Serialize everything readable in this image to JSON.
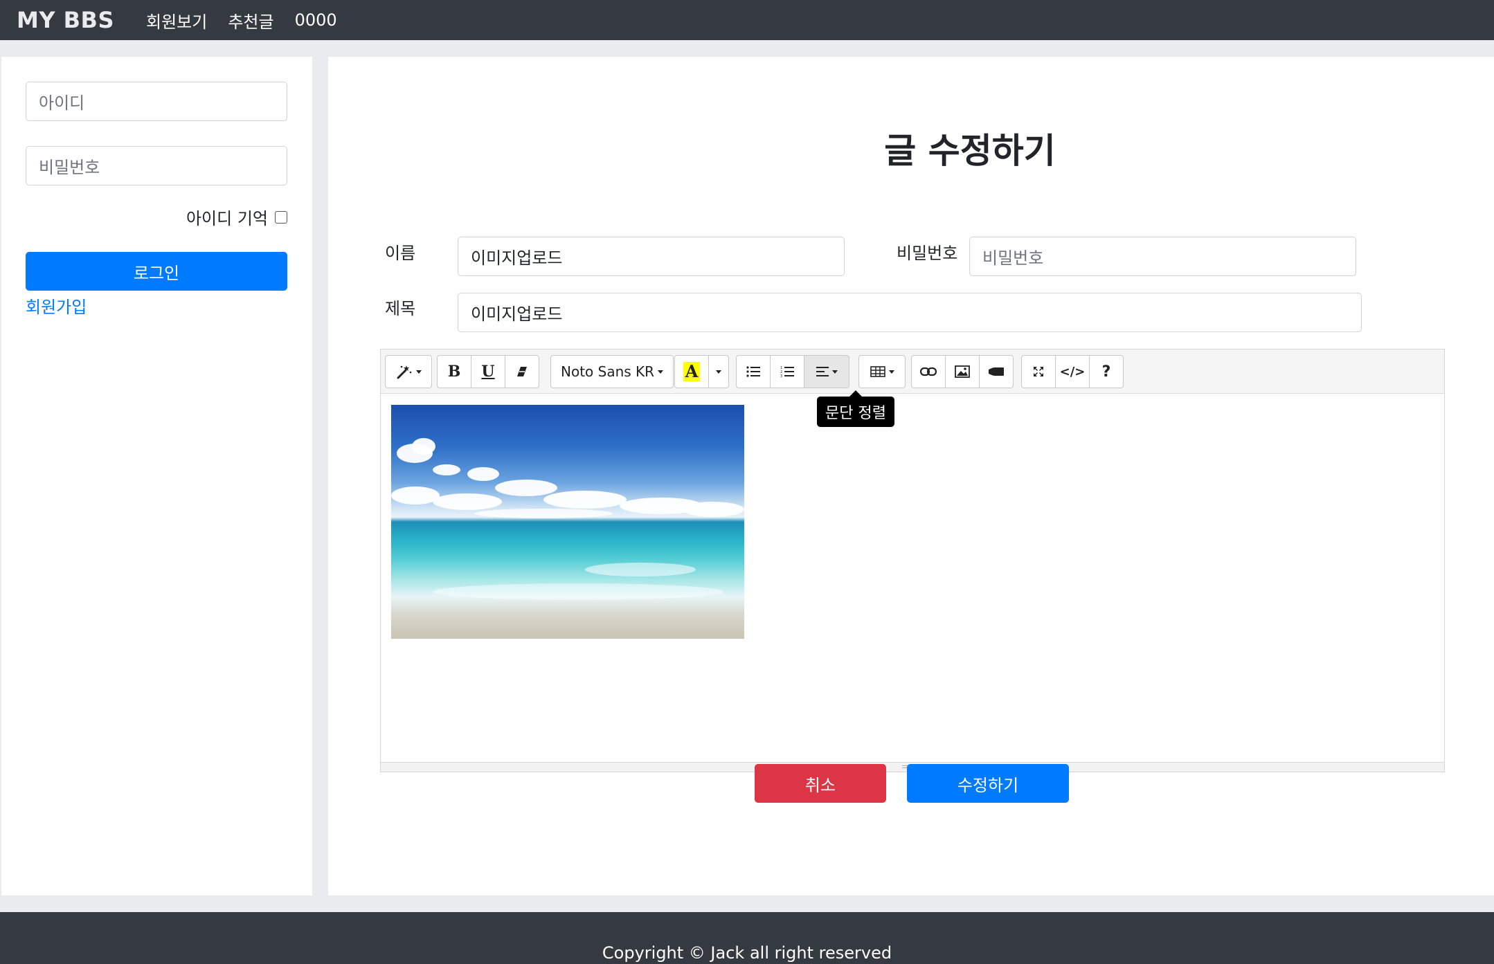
{
  "navbar": {
    "brand": "MY BBS",
    "links": [
      "회원보기",
      "추천글",
      "0000"
    ]
  },
  "sidebar": {
    "id_placeholder": "아이디",
    "password_placeholder": "비밀번호",
    "remember_label": "아이디 기억",
    "remember_checked": false,
    "login_button": "로그인",
    "signup_link": "회원가입"
  },
  "form": {
    "title": "글 수정하기",
    "name_label": "이름",
    "name_value": "이미지업로드",
    "password_label": "비밀번호",
    "password_placeholder": "비밀번호",
    "subject_label": "제목",
    "subject_value": "이미지업로드"
  },
  "editor": {
    "toolbar": {
      "style_icon": "magic-wand-icon",
      "bold": "B",
      "underline": "U",
      "eraser_icon": "eraser-icon",
      "font_name": "Noto Sans KR",
      "color_letter": "A",
      "highlight_color": "#ffff00",
      "unordered_list_icon": "unordered-list-icon",
      "ordered_list_icon": "ordered-list-icon",
      "paragraph_icon": "align-left-icon",
      "table_icon": "table-icon",
      "link_icon": "link-icon",
      "picture_icon": "picture-icon",
      "video_icon": "video-icon",
      "fullscreen_icon": "fullscreen-icon",
      "codeview_label": "</>",
      "help_label": "?"
    },
    "tooltip": "문단 정렬",
    "content_image": "beach-photo"
  },
  "actions": {
    "cancel": "취소",
    "submit": "수정하기"
  },
  "footer": {
    "copyright": "Copyright © Jack all right reserved"
  },
  "colors": {
    "navbar_bg": "#343a40",
    "primary": "#007bff",
    "danger": "#dc3545",
    "page_bg": "#e9ecef"
  }
}
